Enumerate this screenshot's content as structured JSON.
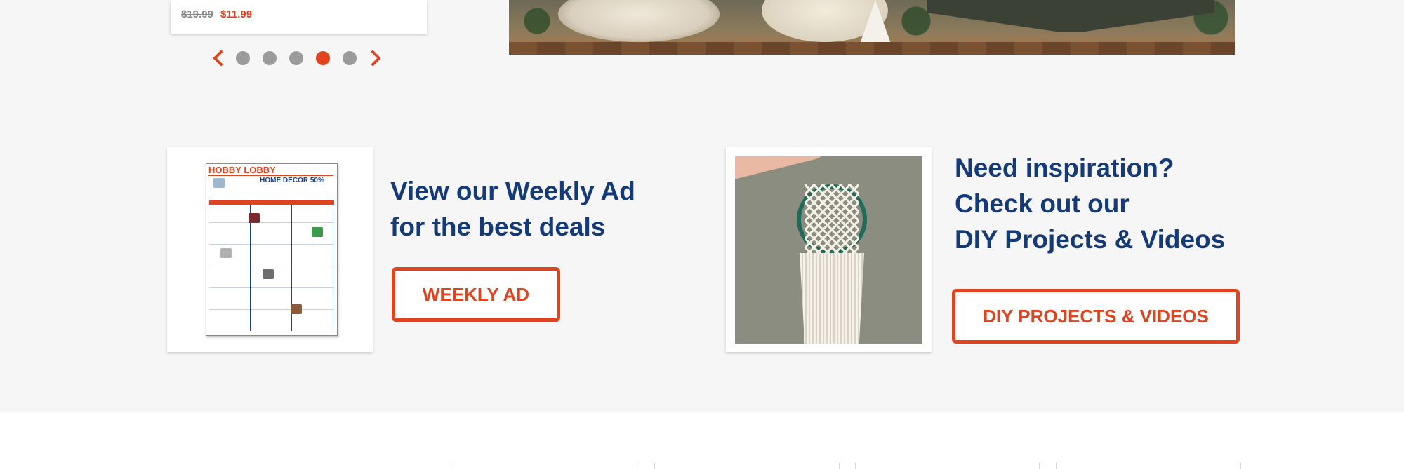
{
  "product": {
    "original_price": "$19.99",
    "sale_price": "$11.99"
  },
  "carousel": {
    "prev_icon": "chevron-left-icon",
    "next_icon": "chevron-right-icon",
    "dot_count": 5,
    "active_index": 3
  },
  "weekly_ad": {
    "heading_line1": "View our Weekly Ad",
    "heading_line2": "for the best deals",
    "button_label": "WEEKLY AD",
    "flyer_brand": "HOBBY LOBBY",
    "flyer_headline": "HOME DECOR 50%"
  },
  "diy": {
    "heading_line1": "Need inspiration?",
    "heading_line2": "Check out our",
    "heading_line3": "DIY Projects & Videos",
    "button_label": "DIY PROJECTS & VIDEOS"
  },
  "colors": {
    "accent": "#e2431f",
    "heading": "#153a7a",
    "section_bg": "#f6f6f6",
    "dot_inactive": "#9b9b9b"
  }
}
